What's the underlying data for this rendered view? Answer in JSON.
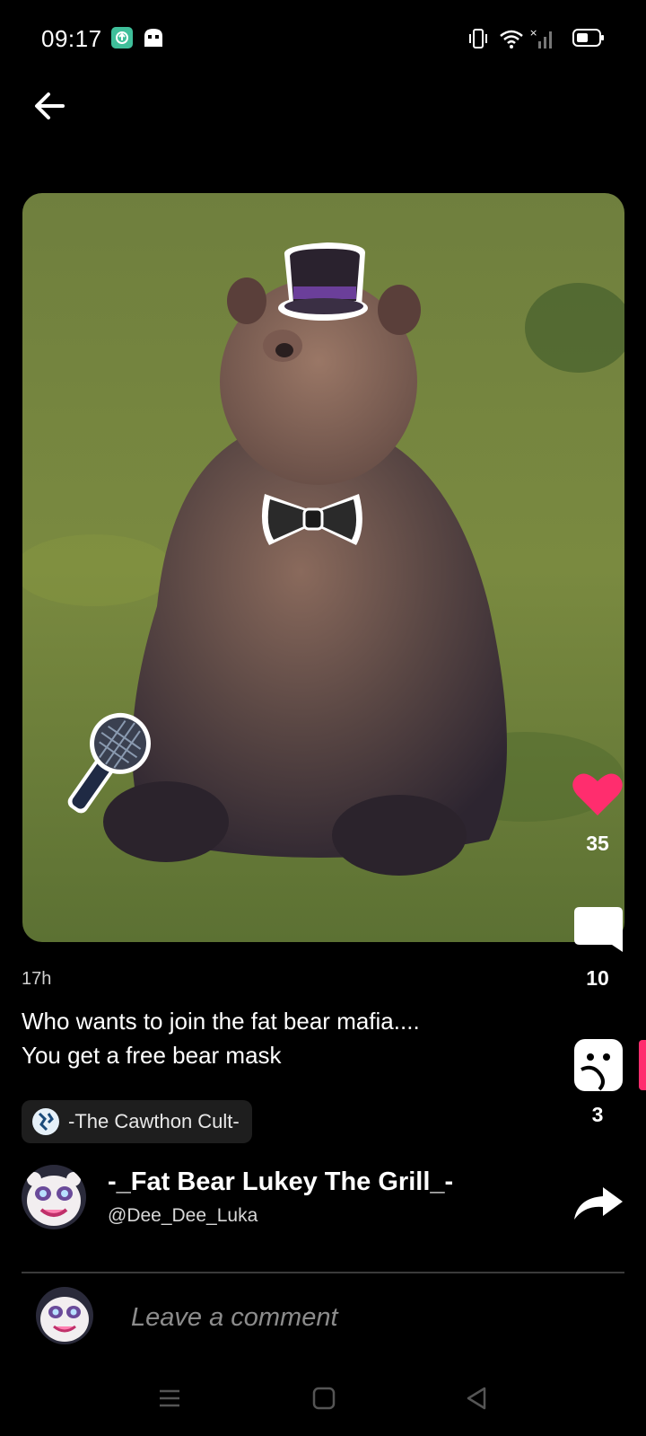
{
  "status_bar": {
    "time": "09:17"
  },
  "post": {
    "timestamp": "17h",
    "caption_line1": "Who wants to join the fat bear mafia....",
    "caption_line2": "You get a free bear mask",
    "community": "-The Cawthon Cult-",
    "author_name": "-_Fat Bear Lukey The Grill_-",
    "author_handle": "@Dee_Dee_Luka"
  },
  "actions": {
    "likes": "35",
    "comments": "10",
    "stickers": "3"
  },
  "comment_box": {
    "placeholder": "Leave a comment"
  },
  "colors": {
    "like": "#ff2d6e",
    "background": "#000000",
    "chip": "#1e1e1e"
  },
  "icons": [
    "back-arrow-icon",
    "heart-icon",
    "comment-bubble-icon",
    "sticker-icon",
    "share-icon",
    "menu-icon",
    "home-icon",
    "back-triangle-icon"
  ]
}
